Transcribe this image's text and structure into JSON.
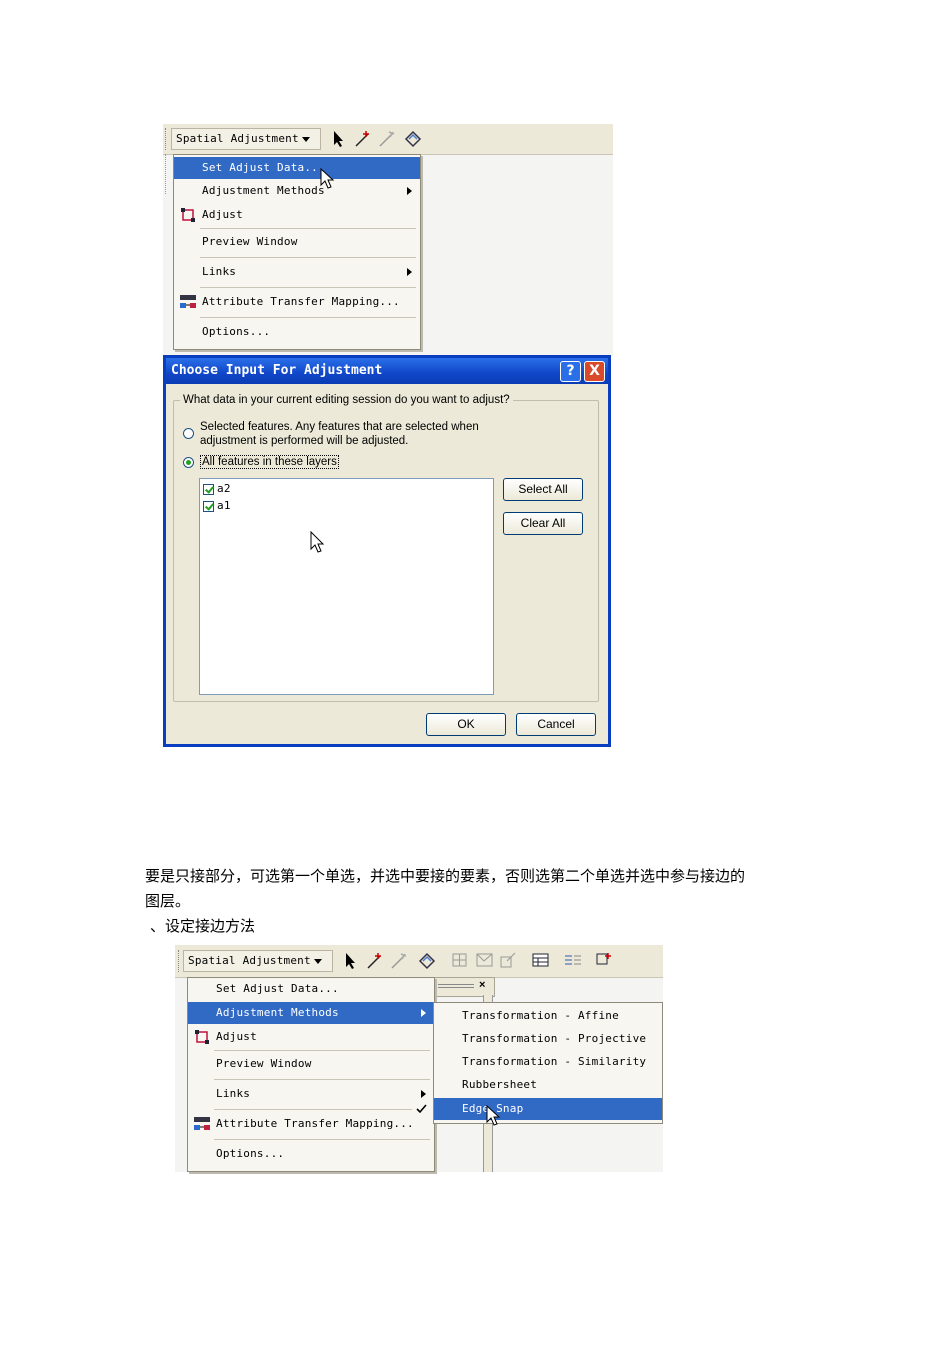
{
  "menu1": {
    "dropdown_label": "Spatial Adjustment",
    "items": [
      {
        "label": "Set Adjust Data...",
        "selected": true,
        "submenu": false
      },
      {
        "label": "Adjustment Methods",
        "selected": false,
        "submenu": true
      },
      {
        "label": "Adjust",
        "selected": false,
        "submenu": false,
        "icon": "adjust-icon"
      },
      {
        "label": "Preview Window",
        "selected": false,
        "submenu": false
      },
      {
        "label": "Links",
        "selected": false,
        "submenu": true
      },
      {
        "label": "Attribute Transfer Mapping...",
        "selected": false,
        "submenu": false,
        "icon": "attribute-mapping-icon"
      },
      {
        "label": "Options...",
        "selected": false,
        "submenu": false
      }
    ]
  },
  "dialog": {
    "title": "Choose Input For Adjustment",
    "help_glyph": "?",
    "close_glyph": "X",
    "group_label": "What data in your current editing session do you want to adjust?",
    "radio_selected_features_line1": "Selected features.  Any features that are selected when",
    "radio_selected_features_line2": "adjustment is performed will be adjusted.",
    "radio_all_features": "All features in these layers",
    "layers": [
      {
        "name": "a2",
        "checked": true
      },
      {
        "name": "a1",
        "checked": true
      }
    ],
    "select_all": "Select All",
    "clear_all": "Clear All",
    "ok": "OK",
    "cancel": "Cancel",
    "selected_option": "all_features"
  },
  "text": {
    "paragraph_line1": "要是只接部分，可选第一个单选，并选中要接的要素，否则选第二个单选并选中参与接边的",
    "paragraph_line2": "图层。",
    "step_heading": "、设定接边方法"
  },
  "menu2": {
    "dropdown_label": "Spatial Adjustment",
    "items": [
      {
        "label": "Set Adjust Data..."
      },
      {
        "label": "Adjustment Methods"
      },
      {
        "label": "Adjust"
      },
      {
        "label": "Preview Window"
      },
      {
        "label": "Links"
      },
      {
        "label": "Attribute Transfer Mapping..."
      },
      {
        "label": "Options..."
      }
    ],
    "submenu": [
      {
        "label": "Transformation - Affine",
        "checked": false
      },
      {
        "label": "Transformation - Projective",
        "checked": false
      },
      {
        "label": "Transformation - Similarity",
        "checked": false
      },
      {
        "label": "Rubbersheet",
        "checked": false
      },
      {
        "label": "Edge Snap",
        "checked": true
      }
    ],
    "panel_close_glyph": "×"
  },
  "colors": {
    "selection": "#316ac5",
    "titlebar": "#0a3ec0",
    "dialog_face": "#ece9d8"
  }
}
